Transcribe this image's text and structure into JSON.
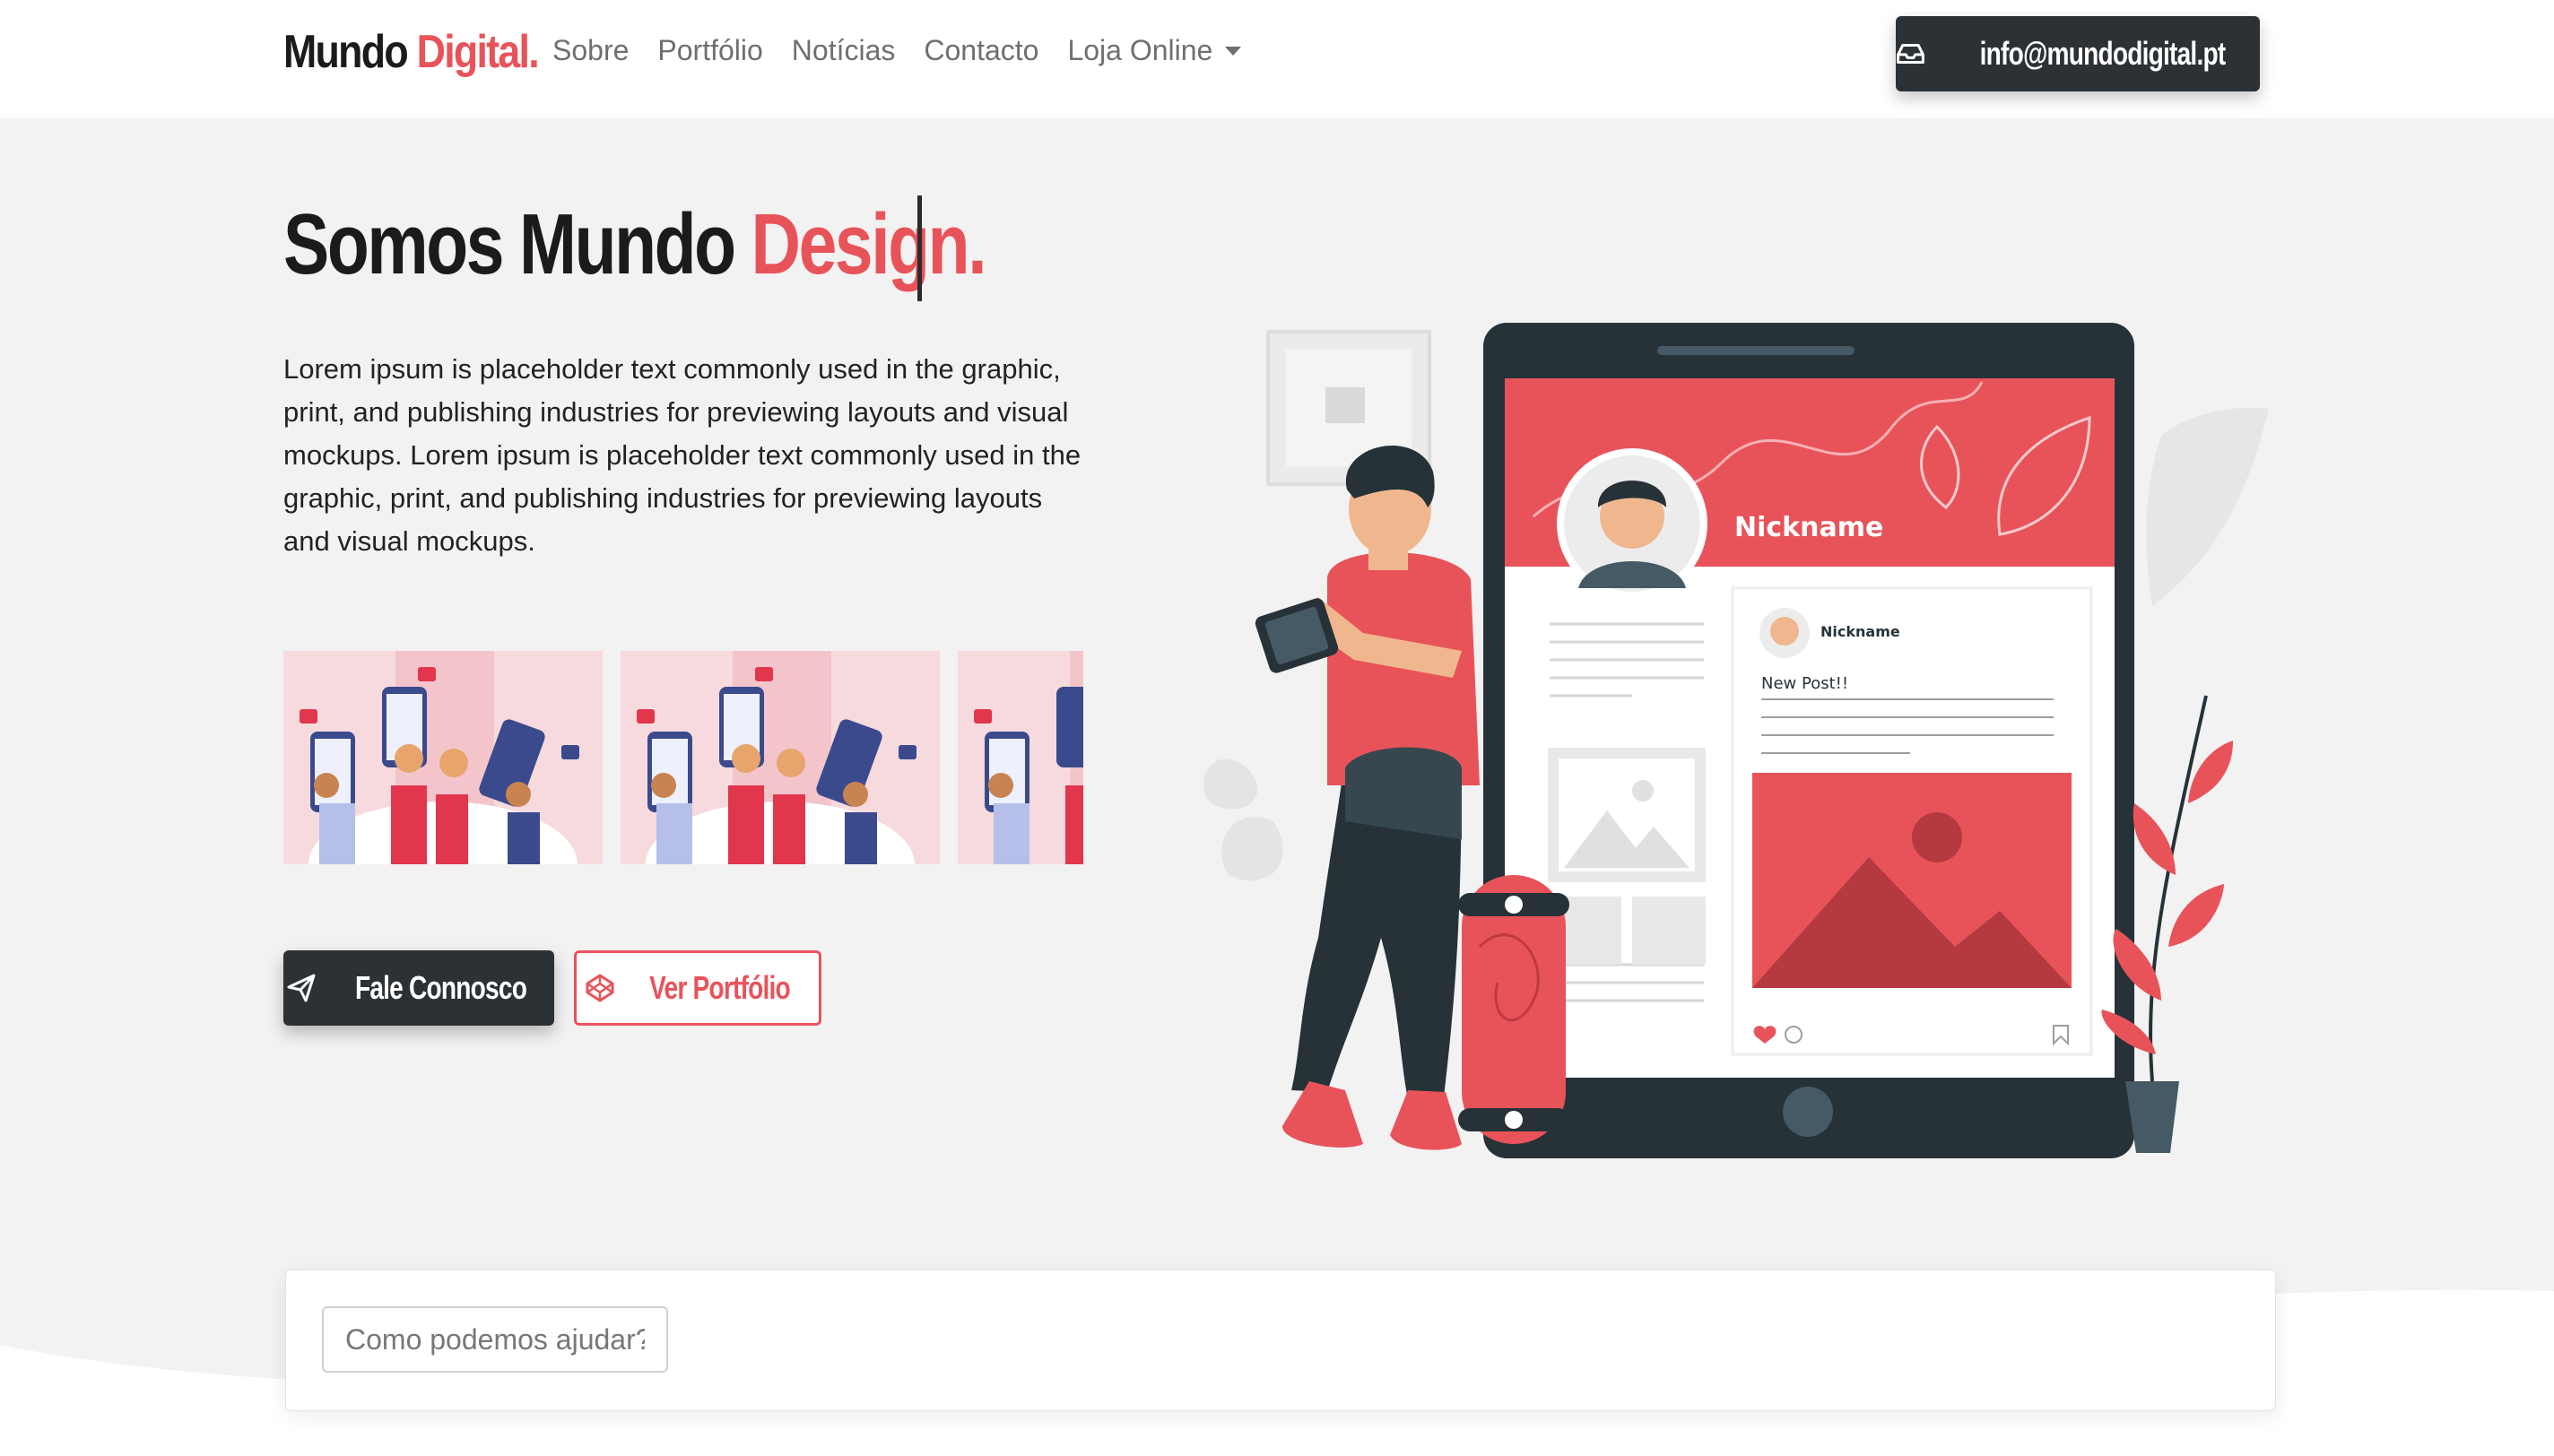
{
  "brand": {
    "name": "Mundo",
    "accent": "Digital."
  },
  "nav": {
    "items": [
      {
        "label": "Sobre"
      },
      {
        "label": "Portfólio"
      },
      {
        "label": "Notícias"
      },
      {
        "label": "Contacto"
      },
      {
        "label": "Loja Online"
      }
    ]
  },
  "header": {
    "email_label": "info@mundodigital.pt",
    "email_icon": "inbox-icon"
  },
  "hero": {
    "title_prefix": "Somos Mundo",
    "title_accent": "Design.",
    "text": "Lorem ipsum is placeholder text commonly used in the graphic, print, and publishing industries for previewing layouts and visual mockups. Lorem ipsum is placeholder text commonly used in the graphic, print, and publishing industries for previewing layouts and visual mockups.",
    "primary_button": "Fale Connosco",
    "primary_icon": "paper-plane-icon",
    "secondary_button": "Ver Portfólio",
    "secondary_icon": "codepen-icon"
  },
  "illustration": {
    "profile_name": "Nickname",
    "post_author": "Nickname",
    "post_text": "New Post!!"
  },
  "search": {
    "placeholder": "Como podemos ajudar?"
  },
  "colors": {
    "accent": "#e8535a",
    "dark": "#2c3135",
    "background": "#f2f2f2"
  }
}
